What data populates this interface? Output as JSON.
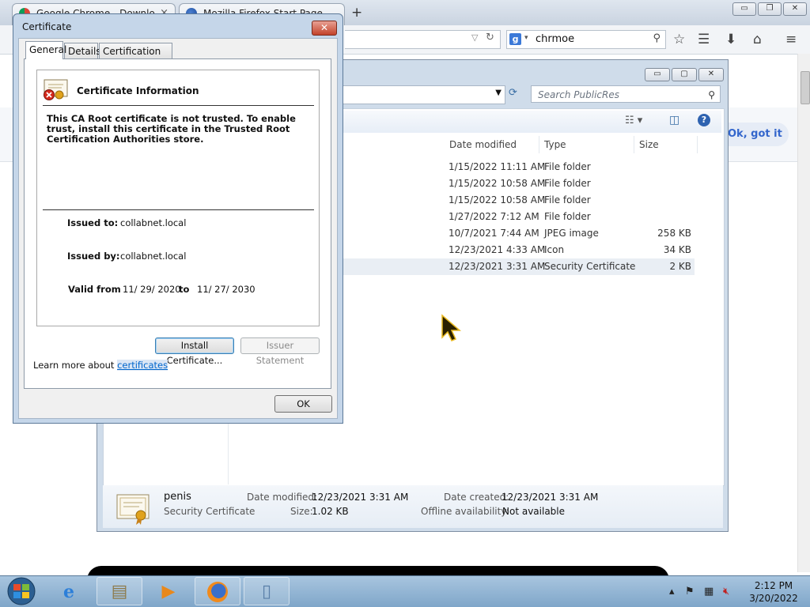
{
  "firefox": {
    "tabs": [
      {
        "label": "Google Chrome - Downlo",
        "close": "×"
      },
      {
        "label": "Mozilla Firefox Start Page",
        "close": "×"
      }
    ],
    "new_tab": "+",
    "search_value": "chrmoe",
    "search_engine_letter": "g",
    "infobar_button": "Ok, got it",
    "window_controls": {
      "minimize": "▭",
      "restore": "❐",
      "close": "✕"
    }
  },
  "explorer": {
    "search_placeholder": "Search PublicRes",
    "columns": [
      "Date modified",
      "Type",
      "Size"
    ],
    "rows": [
      {
        "date": "1/15/2022 11:11 AM",
        "type": "File folder",
        "size": ""
      },
      {
        "date": "1/15/2022 10:58 AM",
        "type": "File folder",
        "size": ""
      },
      {
        "date": "1/15/2022 10:58 AM",
        "type": "File folder",
        "size": ""
      },
      {
        "date": "1/27/2022 7:12 AM",
        "type": "File folder",
        "size": ""
      },
      {
        "date": "10/7/2021 7:44 AM",
        "type": "JPEG image",
        "size": "258 KB"
      },
      {
        "date": "12/23/2021 4:33 AM",
        "type": "Icon",
        "size": "34 KB"
      },
      {
        "date": "12/23/2021 3:31 AM",
        "type": "Security Certificate",
        "size": "2 KB"
      }
    ],
    "details": {
      "name": "penis",
      "kind": "Security Certificate",
      "date_modified_label": "Date modified:",
      "date_modified": "12/23/2021 3:31 AM",
      "size_label": "Size:",
      "size": "1.02 KB",
      "date_created_label": "Date created:",
      "date_created": "12/23/2021 3:31 AM",
      "offline_label": "Offline availability:",
      "offline": "Not available"
    }
  },
  "certificate": {
    "title": "Certificate",
    "close": "✕",
    "tabs": [
      "General",
      "Details",
      "Certification Path"
    ],
    "heading": "Certificate Information",
    "warning": "This CA Root certificate is not trusted. To enable trust, install this certificate in the Trusted Root Certification Authorities store.",
    "issued_to_label": "Issued to:",
    "issued_to": "collabnet.local",
    "issued_by_label": "Issued by:",
    "issued_by": "collabnet.local",
    "valid_from_label": "Valid from",
    "valid_from": "11/ 29/ 2020",
    "to_label": "to",
    "valid_to": "11/ 27/ 2030",
    "install_button": "Install Certificate...",
    "issuer_button": "Issuer Statement",
    "learn_prefix": "Learn more about ",
    "learn_link": "certificates",
    "ok_button": "OK"
  },
  "taskbar": {
    "time": "2:12 PM",
    "date": "3/20/2022"
  }
}
